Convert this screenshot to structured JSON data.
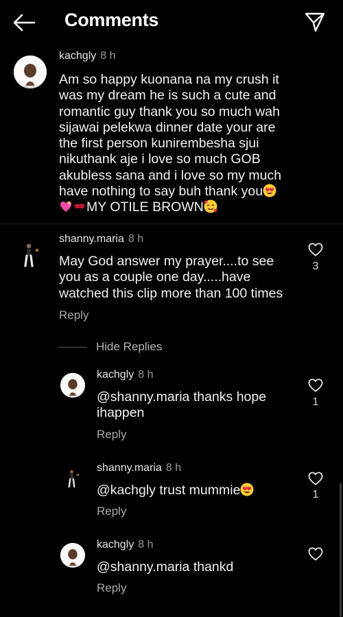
{
  "header": {
    "title": "Comments",
    "back_icon": "back-arrow-icon",
    "send_icon": "send-icon"
  },
  "comments": [
    {
      "username": "kachgly",
      "time": "8 h",
      "text_lines": [
        "Am so happy kuonana na my crush it",
        "was my dream he is such a cute and",
        "romantic guy thank you so much wah",
        "sijawai pelekwa dinner date your are",
        "the first person kunirembesha sjui",
        "nikuthank aje i love so much  GOB",
        "akubless sana and i love so my much",
        "have nothing to say buh thank you",
        "MY OTILE BROWN"
      ],
      "emojis": [
        "heart-eyes",
        "sparkling-heart",
        "kiss-mark",
        "smiling-face-with-hearts"
      ]
    },
    {
      "username": "shanny.maria",
      "time": "8 h",
      "text_lines": [
        "May God answer my prayer....to see",
        "you as a couple one day.....have",
        "watched this clip more than 100 times"
      ],
      "likes": "3",
      "reply_label": "Reply"
    }
  ],
  "hide_replies_label": "Hide Replies",
  "replies": [
    {
      "username": "kachgly",
      "time": "8 h",
      "text_lines": [
        "@shanny.maria thanks hope",
        "ihappen"
      ],
      "likes": "1",
      "reply_label": "Reply"
    },
    {
      "username": "shanny.maria",
      "time": "8 h",
      "text": "@kachgly trust mummie",
      "likes": "1",
      "reply_label": "Reply",
      "emoji": "heart-eyes"
    },
    {
      "username": "kachgly",
      "time": "8 h",
      "text": "@shanny.maria thankd",
      "reply_label": "Reply"
    }
  ]
}
